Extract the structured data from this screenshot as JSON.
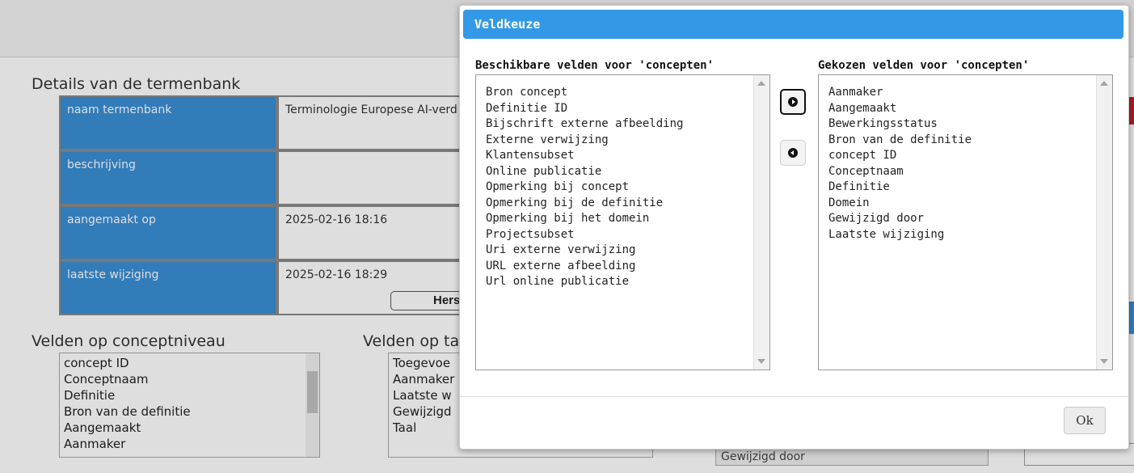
{
  "background": {
    "details_title": "Details van de termenbank",
    "details": [
      {
        "label": "naam termenbank",
        "value": "Terminologie Europese AI-verd"
      },
      {
        "label": "beschrijving",
        "value": ""
      },
      {
        "label": "aangemaakt op",
        "value": "2025-02-16 18:16"
      },
      {
        "label": "laatste wijziging",
        "value": "2025-02-16 18:29"
      }
    ],
    "herstel_button": "Hers",
    "concept_fields_title": "Velden op conceptniveau",
    "concept_fields": [
      "concept ID",
      "Conceptnaam",
      "Definitie",
      "Bron van de definitie",
      "Aangemaakt",
      "Aanmaker"
    ],
    "term_fields_title": "Velden op ta",
    "term_fields": [
      "Toegevoe",
      "Aanmaker",
      "Laatste w",
      "Gewijzigd",
      "Taal"
    ],
    "lower_field_text": "Gewijzigd door"
  },
  "dialog": {
    "title": "Veldkeuze",
    "available_title": "Beschikbare velden voor 'concepten'",
    "available_fields": [
      "Bron concept",
      "Definitie ID",
      "Bijschrift externe afbeelding",
      "Externe verwijzing",
      "Klantensubset",
      "Online publicatie",
      "Opmerking bij concept",
      "Opmerking bij de definitie",
      "Opmerking bij het domein",
      "Projectsubset",
      "Uri externe verwijzing",
      "URL externe afbeelding",
      "Url online publicatie"
    ],
    "chosen_title": "Gekozen velden voor 'concepten'",
    "chosen_fields": [
      "Aanmaker",
      "Aangemaakt",
      "Bewerkingsstatus",
      "Bron van de definitie",
      "concept ID",
      "Conceptnaam",
      "Definitie",
      "Domein",
      "Gewijzigd door",
      "Laatste wijziging"
    ],
    "ok_label": "Ok"
  }
}
